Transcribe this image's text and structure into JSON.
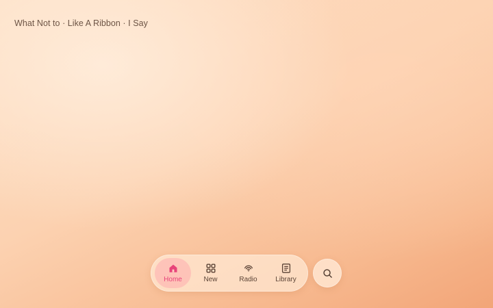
{
  "header": {
    "now_playing_text": "What Not to · Like A Ribbon · I Say"
  },
  "tabbar": {
    "items": [
      {
        "label": "Home",
        "icon": "home-icon",
        "active": true
      },
      {
        "label": "New",
        "icon": "grid-icon",
        "active": false
      },
      {
        "label": "Radio",
        "icon": "radio-icon",
        "active": false
      },
      {
        "label": "Library",
        "icon": "library-icon",
        "active": false
      }
    ],
    "active_color": "#e8437a"
  },
  "search": {
    "icon": "search-icon"
  },
  "colors": {
    "background_top": "#fde0c6",
    "background_bottom": "#f2a578",
    "text": "#6c5445"
  }
}
